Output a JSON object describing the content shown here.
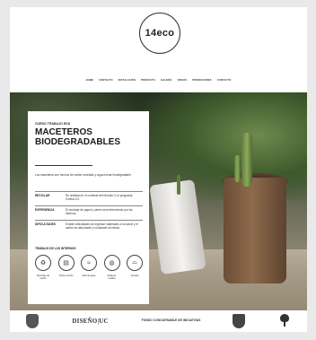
{
  "header": {
    "logo_text": "14eco"
  },
  "nav": {
    "items": [
      "Home",
      "Contacto",
      "Instalación",
      "Producto",
      "Galería",
      "Videos",
      "Promociones",
      "Contacto"
    ]
  },
  "card": {
    "kicker": "CURSO TRABAJO EDS",
    "title": "MACETEROS BIODEGRADABLES",
    "intro": "Los maceteros son hechos de cartón reciclado y agua tornar biodegradable.",
    "rows": [
      {
        "key": "Reciclar",
        "value": "Se reutiliza en el conteste del Módulo 3, el programa Cultiva 2.0."
      },
      {
        "key": "Experiencia",
        "value": "El reciclaje de papel y cartón será intervenido por los internos."
      },
      {
        "key": "Dificultades",
        "value": "Existen dificultades de ingresar materiales a la cárcel y el cartón es abundante y constante al interior."
      }
    ],
    "subhead": "TRABAJO DE LOS INTERNOS",
    "steps": [
      {
        "icon": "recycle-icon",
        "glyph": "♻",
        "label": "Reciclaje de cartón"
      },
      {
        "icon": "shred-icon",
        "glyph": "▤",
        "label": "Triturar cartón"
      },
      {
        "icon": "water-icon",
        "glyph": "≈",
        "label": "Mezcla agua"
      },
      {
        "icon": "mold-icon",
        "glyph": "◍",
        "label": "Rellenar moldes"
      },
      {
        "icon": "pot-icon",
        "glyph": "⌓",
        "label": "Secado"
      }
    ]
  },
  "footer": {
    "sponsor_diseno": "DISEÑO|UC",
    "sponsor_fondo": "FONDO CONCURSABLE DE INICIATIVAS"
  }
}
